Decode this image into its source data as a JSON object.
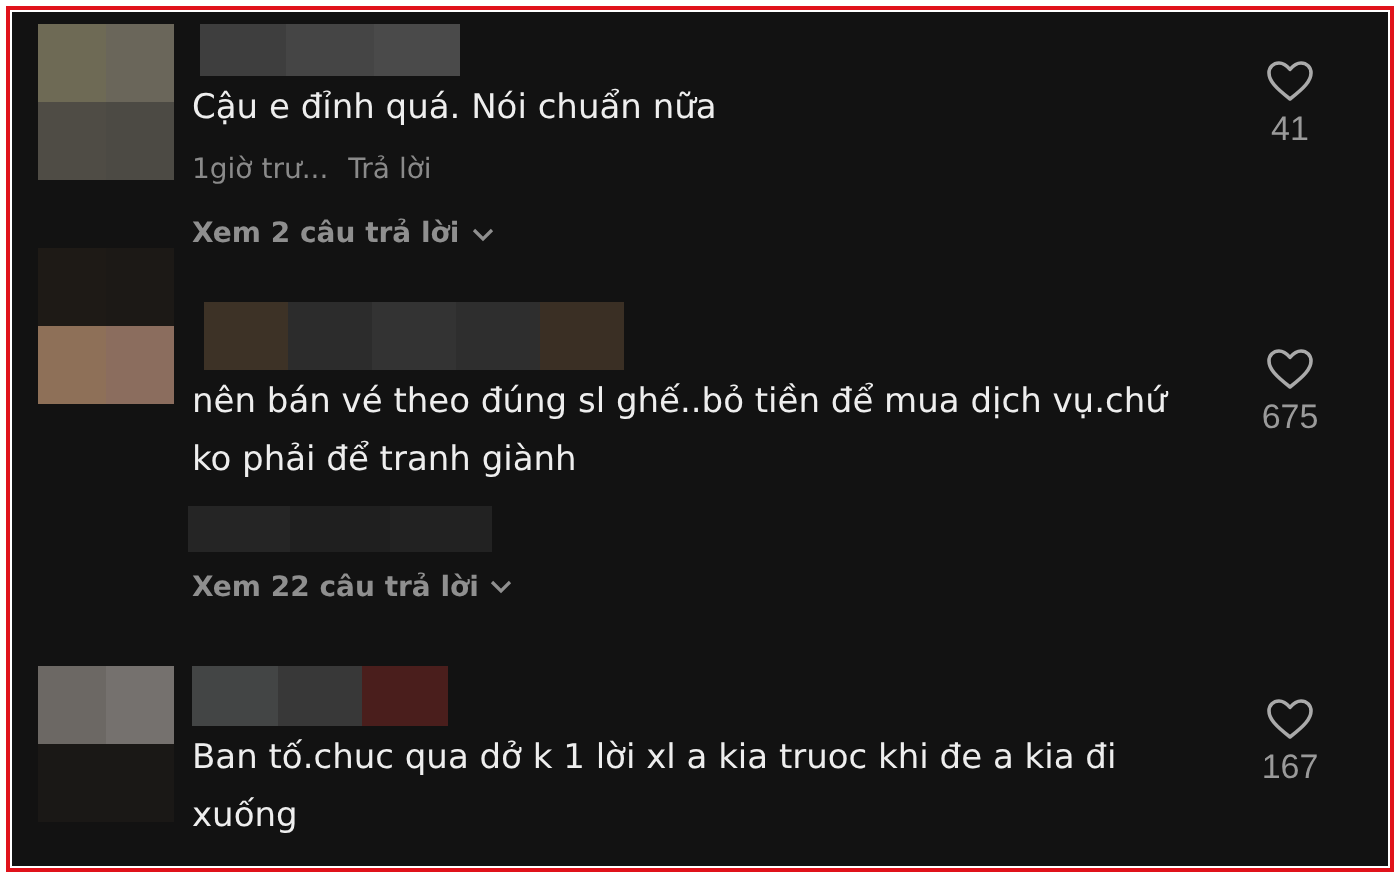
{
  "comments": [
    {
      "text": "Cậu e đỉnh quá. Nói chuẩn nữa",
      "time": "1giờ trư...",
      "reply": "Trả lời",
      "likes": "41",
      "view_replies": "Xem 2 câu trả lời"
    },
    {
      "text": "nên bán vé theo đúng sl ghế..bỏ tiền để mua dịch vụ.chứ ko phải để tranh giành",
      "likes": "675",
      "view_replies": "Xem 22 câu trả lời"
    },
    {
      "text": "Ban tố.chuc qua dở k 1 lời xl a kia truoc khi đe a kia đi xuống",
      "likes": "167"
    }
  ]
}
